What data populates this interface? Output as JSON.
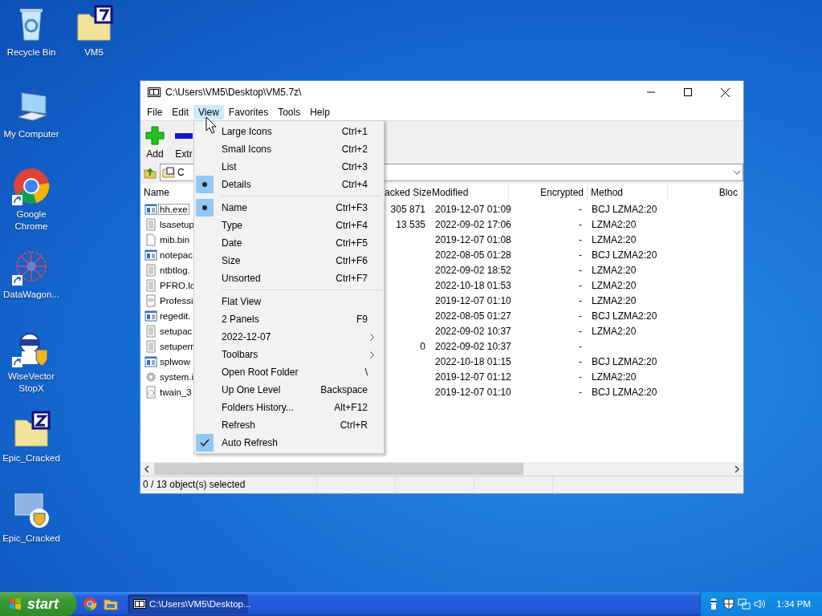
{
  "desktop_icons": [
    {
      "label": "Recycle Bin",
      "kind": "recycle",
      "shortcut": false
    },
    {
      "label": "VM5",
      "kind": "archive7z",
      "shortcut": false
    },
    {
      "label": "My Computer",
      "kind": "computer",
      "shortcut": false
    },
    {
      "label": "Google Chrome",
      "kind": "chrome",
      "shortcut": true
    },
    {
      "label": "DataWagon...",
      "kind": "network",
      "shortcut": true
    },
    {
      "label": "WiseVector StopX",
      "kind": "robot",
      "shortcut": true
    },
    {
      "label": "Epic_Cracked",
      "kind": "archivezip",
      "shortcut": false
    },
    {
      "label": "Epic_Cracked",
      "kind": "monitor",
      "shortcut": false
    }
  ],
  "window": {
    "title": "C:\\Users\\VM5\\Desktop\\VM5.7z\\",
    "menu_bar": [
      {
        "label": "File",
        "selected": false
      },
      {
        "label": "Edit",
        "selected": false
      },
      {
        "label": "View",
        "selected": true
      },
      {
        "label": "Favorites",
        "selected": false
      },
      {
        "label": "Tools",
        "selected": false
      },
      {
        "label": "Help",
        "selected": false
      }
    ],
    "toolbar": [
      {
        "label": "Add",
        "kind": "add"
      },
      {
        "label": "Extr",
        "kind": "extract"
      }
    ],
    "address": {
      "value": "C"
    },
    "columns": [
      "Name",
      "acked Size",
      "Modified",
      "Encrypted",
      "Method",
      "Bloc"
    ],
    "rows": [
      {
        "name": "hh.exe",
        "kind": "exe",
        "focused": true,
        "packed_size": "305 871",
        "modified": "2019-12-07 01:09",
        "encrypted": "-",
        "method": "BCJ LZMA2:20"
      },
      {
        "name": "lsasetup",
        "kind": "text",
        "focused": false,
        "packed_size": "13 535",
        "modified": "2022-09-02 17:06",
        "encrypted": "-",
        "method": "LZMA2:20"
      },
      {
        "name": "mib.bin",
        "kind": "blank",
        "focused": false,
        "packed_size": "",
        "modified": "2019-12-07 01:08",
        "encrypted": "-",
        "method": "LZMA2:20"
      },
      {
        "name": "notepac",
        "kind": "exe",
        "focused": false,
        "packed_size": "",
        "modified": "2022-08-05 01:28",
        "encrypted": "-",
        "method": "BCJ LZMA2:20"
      },
      {
        "name": "ntbtlog.",
        "kind": "text",
        "focused": false,
        "packed_size": "",
        "modified": "2022-09-02 18:52",
        "encrypted": "-",
        "method": "LZMA2:20"
      },
      {
        "name": "PFRO.lo",
        "kind": "text",
        "focused": false,
        "packed_size": "",
        "modified": "2022-10-18 01:53",
        "encrypted": "-",
        "method": "LZMA2:20"
      },
      {
        "name": "Professi",
        "kind": "markup",
        "focused": false,
        "packed_size": "",
        "modified": "2019-12-07 01:10",
        "encrypted": "-",
        "method": "LZMA2:20"
      },
      {
        "name": "regedit.",
        "kind": "exe",
        "focused": false,
        "packed_size": "",
        "modified": "2022-08-05 01:27",
        "encrypted": "-",
        "method": "BCJ LZMA2:20"
      },
      {
        "name": "setupac",
        "kind": "text",
        "focused": false,
        "packed_size": "",
        "modified": "2022-09-02 10:37",
        "encrypted": "-",
        "method": "LZMA2:20"
      },
      {
        "name": "setuperr",
        "kind": "text",
        "focused": false,
        "packed_size": "0",
        "modified": "2022-09-02 10:37",
        "encrypted": "-",
        "method": ""
      },
      {
        "name": "splwow",
        "kind": "exe",
        "focused": false,
        "packed_size": "",
        "modified": "2022-10-18 01:15",
        "encrypted": "-",
        "method": "BCJ LZMA2:20"
      },
      {
        "name": "system.i",
        "kind": "settings",
        "focused": false,
        "packed_size": "",
        "modified": "2019-12-07 01:12",
        "encrypted": "-",
        "method": "LZMA2:20"
      },
      {
        "name": "twain_3",
        "kind": "library",
        "focused": false,
        "packed_size": "",
        "modified": "2019-12-07 01:10",
        "encrypted": "-",
        "method": "BCJ LZMA2:20"
      }
    ],
    "status_bar": "0 / 13 object(s) selected",
    "view_menu": [
      [
        {
          "label": "Large Icons",
          "shortcut": "Ctrl+1",
          "kind": "radio",
          "checked": false
        },
        {
          "label": "Small Icons",
          "shortcut": "Ctrl+2",
          "kind": "radio",
          "checked": false
        },
        {
          "label": "List",
          "shortcut": "Ctrl+3",
          "kind": "radio",
          "checked": false
        },
        {
          "label": "Details",
          "shortcut": "Ctrl+4",
          "kind": "radio",
          "checked": true
        }
      ],
      [
        {
          "label": "Name",
          "shortcut": "Ctrl+F3",
          "kind": "radio",
          "checked": true
        },
        {
          "label": "Type",
          "shortcut": "Ctrl+F4",
          "kind": "radio",
          "checked": false
        },
        {
          "label": "Date",
          "shortcut": "Ctrl+F5",
          "kind": "radio",
          "checked": false
        },
        {
          "label": "Size",
          "shortcut": "Ctrl+F6",
          "kind": "radio",
          "checked": false
        },
        {
          "label": "Unsorted",
          "shortcut": "Ctrl+F7",
          "kind": "radio",
          "checked": false
        }
      ],
      [
        {
          "label": "Flat View",
          "kind": "check",
          "checked": false
        },
        {
          "label": "2 Panels",
          "shortcut": "F9",
          "kind": "check",
          "checked": false
        },
        {
          "label": "2022-12-07",
          "kind": "submenu",
          "checked": false
        },
        {
          "label": "Toolbars",
          "kind": "submenu",
          "checked": false
        },
        {
          "label": "Open Root Folder",
          "shortcut": "\\",
          "kind": "command",
          "checked": false
        },
        {
          "label": "Up One Level",
          "shortcut": "Backspace",
          "kind": "command",
          "checked": false
        },
        {
          "label": "Folders History...",
          "shortcut": "Alt+F12",
          "kind": "command",
          "checked": false
        },
        {
          "label": "Refresh",
          "shortcut": "Ctrl+R",
          "kind": "command",
          "checked": false
        },
        {
          "label": "Auto Refresh",
          "kind": "check",
          "checked": true
        }
      ]
    ]
  },
  "taskbar": {
    "start": "start",
    "tasks": [
      {
        "label": "C:\\Users\\VM5\\Desktop...",
        "selected": true
      }
    ],
    "clock": "1:34 PM"
  }
}
